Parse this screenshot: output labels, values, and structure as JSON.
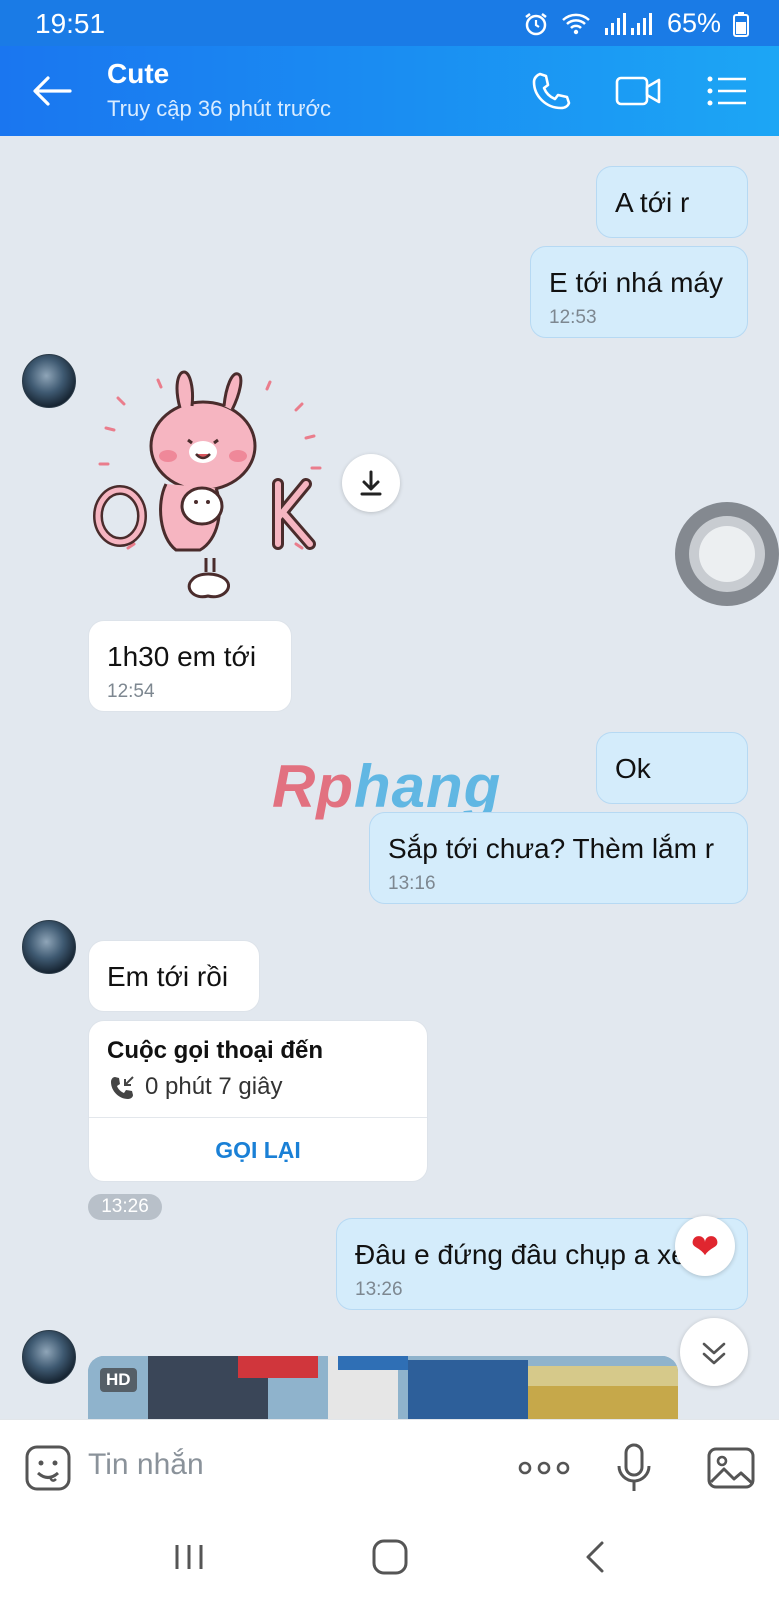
{
  "status_bar": {
    "time": "19:51",
    "battery": "65%"
  },
  "header": {
    "title": "Cute",
    "subtitle": "Truy cập 36 phút trước"
  },
  "messages": {
    "m1": {
      "text": "A tới r"
    },
    "m2": {
      "text": "E tới nhá máy",
      "time": "12:53"
    },
    "m3": {
      "text": "1h30 em tới",
      "time": "12:54"
    },
    "m4": {
      "text": "Ok"
    },
    "m5": {
      "text": "Sắp tới chưa? Thèm lắm r",
      "time": "13:16"
    },
    "m6": {
      "text": "Em tới rồi"
    },
    "call": {
      "title": "Cuộc gọi thoại đến",
      "duration": "0 phút 7 giây",
      "callback": "GỌI LẠI",
      "time": "13:26"
    },
    "m7": {
      "text": "Đâu e đứng đâu chụp a xem",
      "time": "13:26"
    },
    "photo": {
      "badge": "HD"
    }
  },
  "watermark": {
    "part1": "Rp",
    "part2": "hang"
  },
  "composer": {
    "placeholder": "Tin nhắn"
  },
  "colors": {
    "header_start": "#1a76f0",
    "header_end": "#1ca6f5",
    "outgoing_bubble": "#d4ecfb",
    "incoming_bubble": "#ffffff",
    "link": "#1a80d6"
  }
}
